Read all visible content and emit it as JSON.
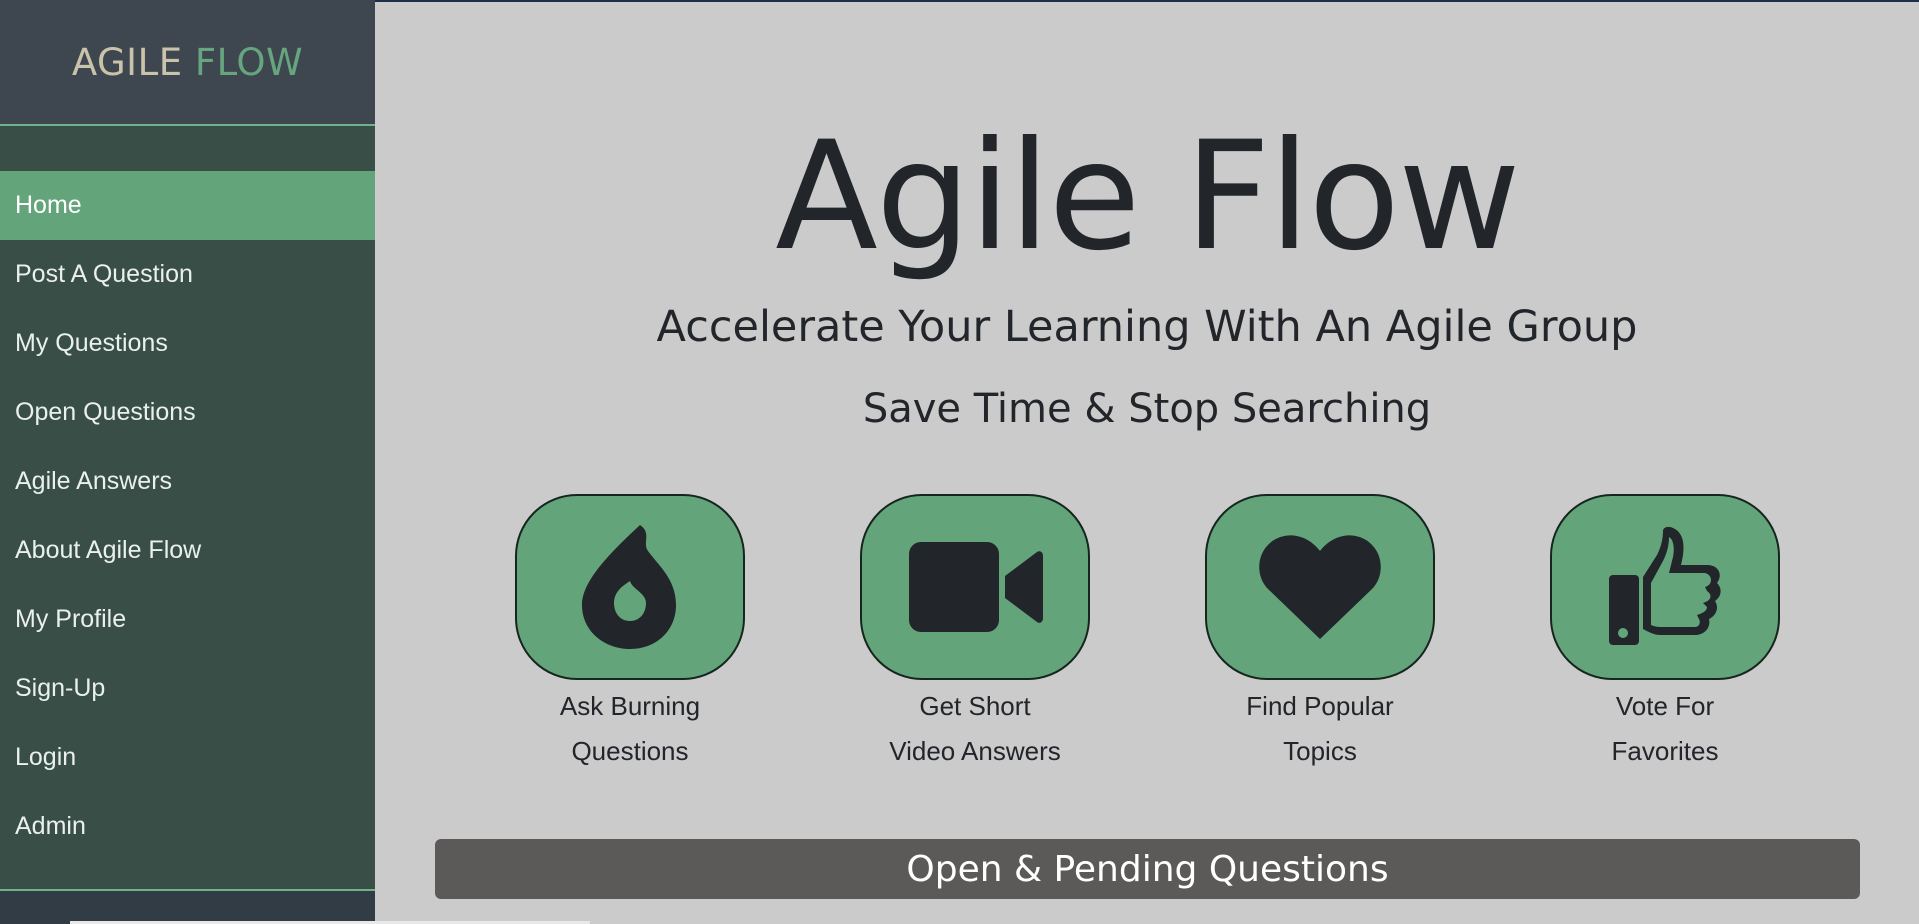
{
  "brand": {
    "part1": "AGILE",
    "part2": "FLOW"
  },
  "nav": [
    {
      "label": "Home",
      "active": true
    },
    {
      "label": "Post A Question"
    },
    {
      "label": "My Questions"
    },
    {
      "label": "Open Questions"
    },
    {
      "label": "Agile Answers"
    },
    {
      "label": "About Agile Flow"
    },
    {
      "label": "My Profile"
    },
    {
      "label": "Sign-Up"
    },
    {
      "label": "Login"
    },
    {
      "label": "Admin"
    }
  ],
  "hero": {
    "title": "Agile Flow",
    "subtitle": "Accelerate Your Learning With An Agile Group",
    "tagline": "Save Time & Stop Searching"
  },
  "features": [
    {
      "icon": "fire-icon",
      "line1": "Ask Burning",
      "line2": "Questions"
    },
    {
      "icon": "video-camera-icon",
      "line1": "Get Short",
      "line2": "Video Answers"
    },
    {
      "icon": "heart-icon",
      "line1": "Find Popular",
      "line2": "Topics"
    },
    {
      "icon": "thumbs-up-icon",
      "line1": "Vote For",
      "line2": "Favorites"
    }
  ],
  "open_section": {
    "title": "Open & Pending Questions"
  },
  "colors": {
    "sidebar": "#3a4e48",
    "brand_bg": "#3e4650",
    "accent": "#63a47b",
    "main_bg": "#cbcbcb",
    "text": "#22252a",
    "section_bar": "#5b5a58"
  }
}
